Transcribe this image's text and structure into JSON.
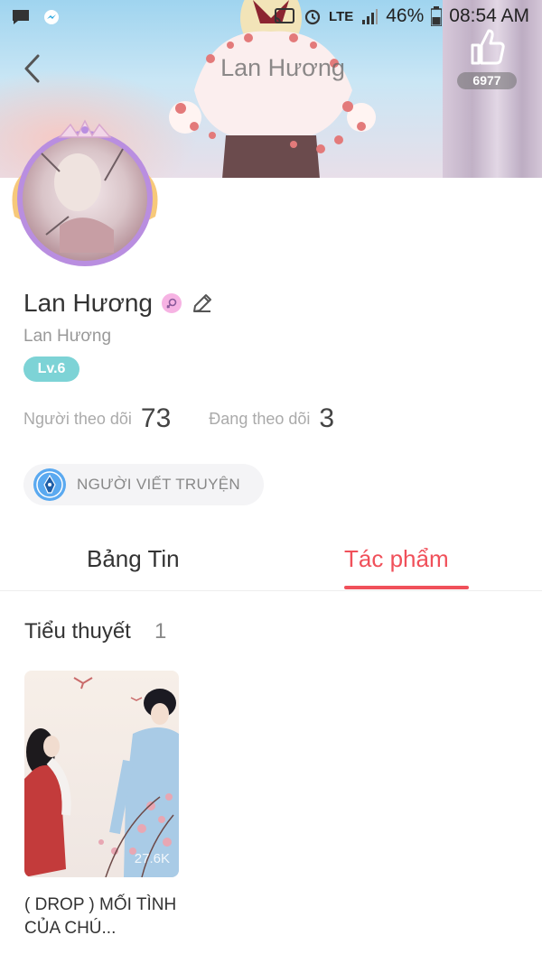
{
  "status_bar": {
    "lte": "LTE",
    "battery": "46%",
    "time": "08:54 AM"
  },
  "header": {
    "title": "Lan Hương",
    "like_count": "6977"
  },
  "profile": {
    "name": "Lan Hương",
    "username": "Lan Hương",
    "level": "Lv.6",
    "followers_label": "Người theo dõi",
    "followers_count": "73",
    "following_label": "Đang theo dõi",
    "following_count": "3",
    "role_badge": "NGƯỜI VIẾT TRUYỆN"
  },
  "tabs": [
    {
      "label": "Bảng Tin",
      "active": false
    },
    {
      "label": "Tác phẩm",
      "active": true
    }
  ],
  "section": {
    "title": "Tiểu thuyết",
    "count": "1"
  },
  "books": [
    {
      "title": "( DROP ) MỐI TÌNH CỦA CHÚ...",
      "views": "27.6K"
    }
  ],
  "colors": {
    "accent": "#f0505a",
    "level_badge": "#7dd3d6",
    "gender_badge": "#f6b3e3"
  },
  "icons": [
    "message-icon",
    "messenger-icon",
    "back-icon",
    "like-icon",
    "edit-icon",
    "gender-icon",
    "pen-nib-icon"
  ]
}
